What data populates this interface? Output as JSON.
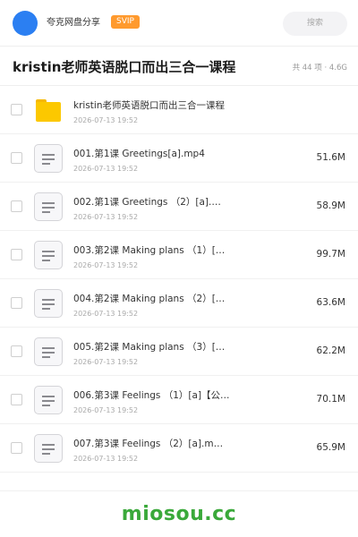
{
  "header": {
    "brand": "夸克网盘分享",
    "badge": "SVIP",
    "search_placeholder": "搜索"
  },
  "share": {
    "title": "kristin老师英语脱口而出三合一课程",
    "summary": "共 44 项 · 4.6G"
  },
  "files": [
    {
      "name": "kristin老师英语脱口而出三合一课程",
      "date": "2026-07-13 19:52",
      "size": "",
      "icon": "folder-icon"
    },
    {
      "name": "001.第1课 Greetings[a].mp4",
      "date": "2026-07-13 19:52",
      "size": "51.6M",
      "icon": "file-icon"
    },
    {
      "name": "002.第1课 Greetings （2）[a].…",
      "date": "2026-07-13 19:52",
      "size": "58.9M",
      "icon": "file-icon"
    },
    {
      "name": "003.第2课 Making plans （1）[…",
      "date": "2026-07-13 19:52",
      "size": "99.7M",
      "icon": "file-icon"
    },
    {
      "name": "004.第2课 Making plans （2）[…",
      "date": "2026-07-13 19:52",
      "size": "63.6M",
      "icon": "file-icon"
    },
    {
      "name": "005.第2课 Making plans （3）[…",
      "date": "2026-07-13 19:52",
      "size": "62.2M",
      "icon": "file-icon"
    },
    {
      "name": "006.第3课 Feelings （1）[a]【公…",
      "date": "2026-07-13 19:52",
      "size": "70.1M",
      "icon": "file-icon"
    },
    {
      "name": "007.第3课 Feelings （2）[a].m…",
      "date": "2026-07-13 19:52",
      "size": "65.9M",
      "icon": "file-icon"
    }
  ],
  "footer": {
    "watermark": "miosou.cc"
  },
  "colors": {
    "avatar": "#2b7ff2",
    "badge": "#ff9a2e",
    "folder": "#fcc800",
    "watermark": "#3aa93a"
  }
}
